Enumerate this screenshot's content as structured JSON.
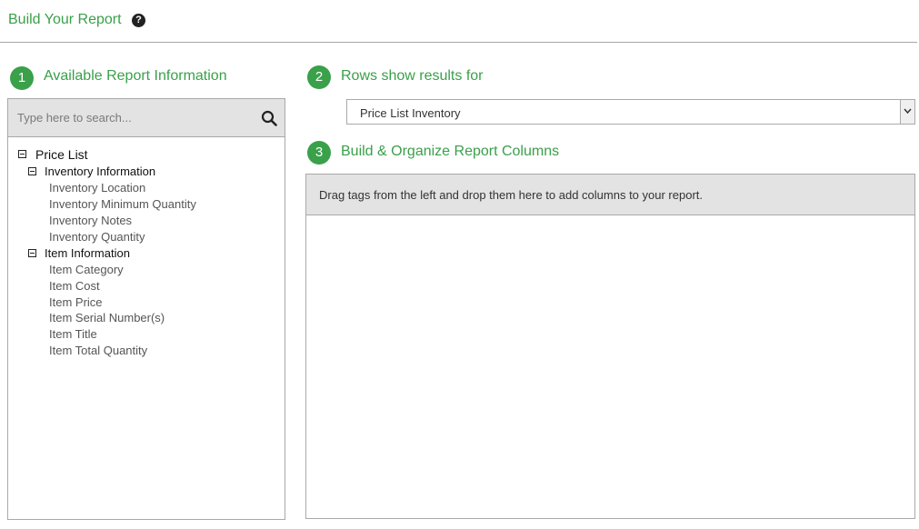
{
  "header": {
    "title": "Build Your Report",
    "help_icon": "question-circle-icon"
  },
  "steps": [
    {
      "number": "1",
      "title": "Available Report Information"
    },
    {
      "number": "2",
      "title": "Rows show results for"
    },
    {
      "number": "3",
      "title": "Build & Organize Report Columns"
    }
  ],
  "search": {
    "placeholder": "Type here to search...",
    "value": ""
  },
  "tree": {
    "root": "Price List",
    "groups": [
      {
        "label": "Inventory Information",
        "items": [
          "Inventory Location",
          "Inventory Minimum Quantity",
          "Inventory Notes",
          "Inventory Quantity"
        ]
      },
      {
        "label": "Item Information",
        "items": [
          "Item Category",
          "Item Cost",
          "Item Price",
          "Item Serial Number(s)",
          "Item Title",
          "Item Total Quantity"
        ]
      }
    ]
  },
  "rows_select": {
    "value": "Price List Inventory"
  },
  "drop_zone": {
    "hint": "Drag tags from the left and drop them here to add columns to your report."
  },
  "colors": {
    "accent": "#3aa04a",
    "panel_bg": "#e3e3e3",
    "border": "#a9a9a9"
  }
}
